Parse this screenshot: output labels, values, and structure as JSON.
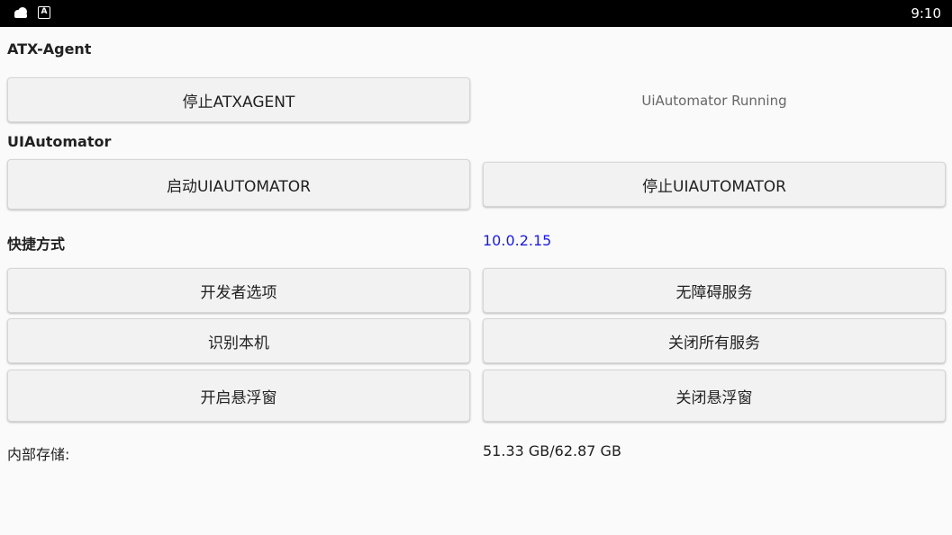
{
  "status_bar": {
    "time": "9:10",
    "icons": [
      "cloud-icon",
      "a-app-icon"
    ],
    "a_icon_text": "A"
  },
  "atx_agent": {
    "title": "ATX-Agent",
    "stop_button": "停止ATXAGENT",
    "status_text": "UiAutomator Running"
  },
  "uiautomator": {
    "title": "UIAutomator",
    "start_button": "启动UIAUTOMATOR",
    "stop_button": "停止UIAUTOMATOR"
  },
  "shortcuts": {
    "title": "快捷方式",
    "ip_address": "10.0.2.15",
    "buttons": {
      "developer_options": "开发者选项",
      "accessibility": "无障碍服务",
      "identify_device": "识别本机",
      "close_all_services": "关闭所有服务",
      "open_float_window": "开启悬浮窗",
      "close_float_window": "关闭悬浮窗"
    }
  },
  "storage": {
    "label": "内部存储:",
    "value": "51.33 GB/62.87 GB"
  },
  "colors": {
    "ip_link": "#1a1ae6",
    "status_muted": "#666666"
  }
}
